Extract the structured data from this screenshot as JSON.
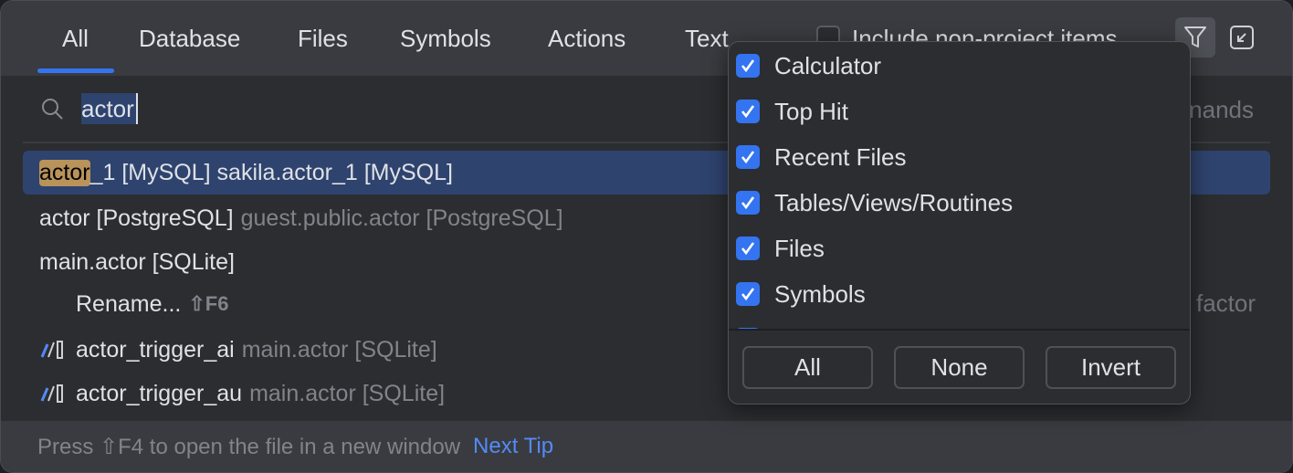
{
  "tabs": [
    {
      "label": "All",
      "active": true
    },
    {
      "label": "Database"
    },
    {
      "label": "Files"
    },
    {
      "label": "Symbols"
    },
    {
      "label": "Actions"
    },
    {
      "label": "Text"
    }
  ],
  "include_non_project": {
    "label": "Include non-project items",
    "checked": false
  },
  "toolbar": {
    "filter_icon": "filter-icon",
    "collapse_icon": "collapse-icon"
  },
  "search": {
    "value": "actor",
    "right_hint": "nands"
  },
  "results": [
    {
      "match": "actor",
      "name": "_1 [MySQL] sakila.actor_1 [MySQL]",
      "selected": true
    },
    {
      "name": "actor [PostgreSQL]",
      "detail": "guest.public.actor [PostgreSQL]"
    },
    {
      "name": "main.actor [SQLite]"
    },
    {
      "name": "Rename...",
      "shortcut": "⇧F6",
      "right": "factor"
    },
    {
      "name": "actor_trigger_ai",
      "detail": "main.actor [SQLite]",
      "icon": "trigger-icon"
    },
    {
      "name": "actor_trigger_au",
      "detail": "main.actor [SQLite]",
      "icon": "trigger-icon"
    }
  ],
  "footer": {
    "tip": "Press ⇧F4 to open the file in a new window",
    "next_tip": "Next Tip"
  },
  "filter_popup": {
    "items": [
      {
        "label": "Calculator",
        "checked": true
      },
      {
        "label": "Top Hit",
        "checked": true
      },
      {
        "label": "Recent Files",
        "checked": true
      },
      {
        "label": "Tables/Views/Routines",
        "checked": true
      },
      {
        "label": "Files",
        "checked": true
      },
      {
        "label": "Symbols",
        "checked": true
      }
    ],
    "buttons": {
      "all": "All",
      "none": "None",
      "invert": "Invert"
    }
  },
  "colors": {
    "accent": "#3574f0",
    "selection": "#2e436e",
    "match_highlight": "#b8935a",
    "link": "#548af7"
  }
}
